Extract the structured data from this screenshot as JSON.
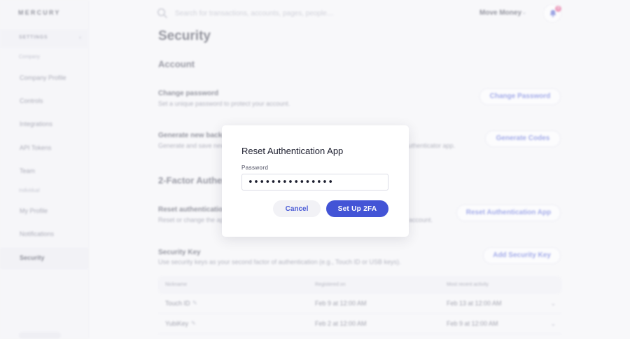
{
  "brand": {
    "logo_text": "MERCURY"
  },
  "sidebar": {
    "section_label": "SETTINGS",
    "groups": {
      "company": "Company",
      "individual": "Individual"
    },
    "company_items": [
      {
        "label": "Company Profile"
      },
      {
        "label": "Controls"
      },
      {
        "label": "Integrations"
      },
      {
        "label": "API Tokens"
      },
      {
        "label": "Team"
      }
    ],
    "individual_items": [
      {
        "label": "My Profile"
      },
      {
        "label": "Notifications"
      },
      {
        "label": "Security"
      }
    ]
  },
  "topbar": {
    "search_placeholder": "Search for transactions, accounts, pages, people…",
    "account_label": "Move Money",
    "notification_count": "3"
  },
  "main": {
    "page_title": "Security",
    "account_section": {
      "heading": "Account",
      "change_password": {
        "title": "Change password",
        "description": "Set a unique password to protect your account.",
        "button": "Change Password"
      },
      "backup_codes": {
        "title": "Generate new backup codes",
        "description": "Generate and save new codes",
        "description_tail": "your authenticator app.",
        "button": "Generate Codes"
      }
    },
    "twofa_section": {
      "heading": "2-Factor Authentication",
      "reset_app": {
        "title": "Reset authentication app",
        "description": "Reset or change the app",
        "description_tail": "account.",
        "button": "Reset Authentication App"
      },
      "security_key": {
        "title": "Security Key",
        "description": "Use security keys as your second factor of authentication (e.g., Touch ID or USB keys).",
        "button": "Add Security Key"
      }
    },
    "keys_table": {
      "columns": [
        "Nickname",
        "Registered on",
        "Most recent activity"
      ],
      "rows": [
        {
          "nickname": "Touch ID",
          "registered": "Feb 9 at 12:00 AM",
          "activity": "Feb 13 at 12:00 AM"
        },
        {
          "nickname": "YubiKey",
          "registered": "Feb 2 at 12:00 AM",
          "activity": "Feb 9 at 12:00 AM"
        }
      ]
    }
  },
  "modal": {
    "title": "Reset Authentication App",
    "password_label": "Password",
    "password_value": "•••••••••••••••",
    "cancel_label": "Cancel",
    "confirm_label": "Set Up 2FA"
  },
  "colors": {
    "accent": "#4354d6",
    "link": "#4a5bd6",
    "badge": "#e0427d"
  }
}
